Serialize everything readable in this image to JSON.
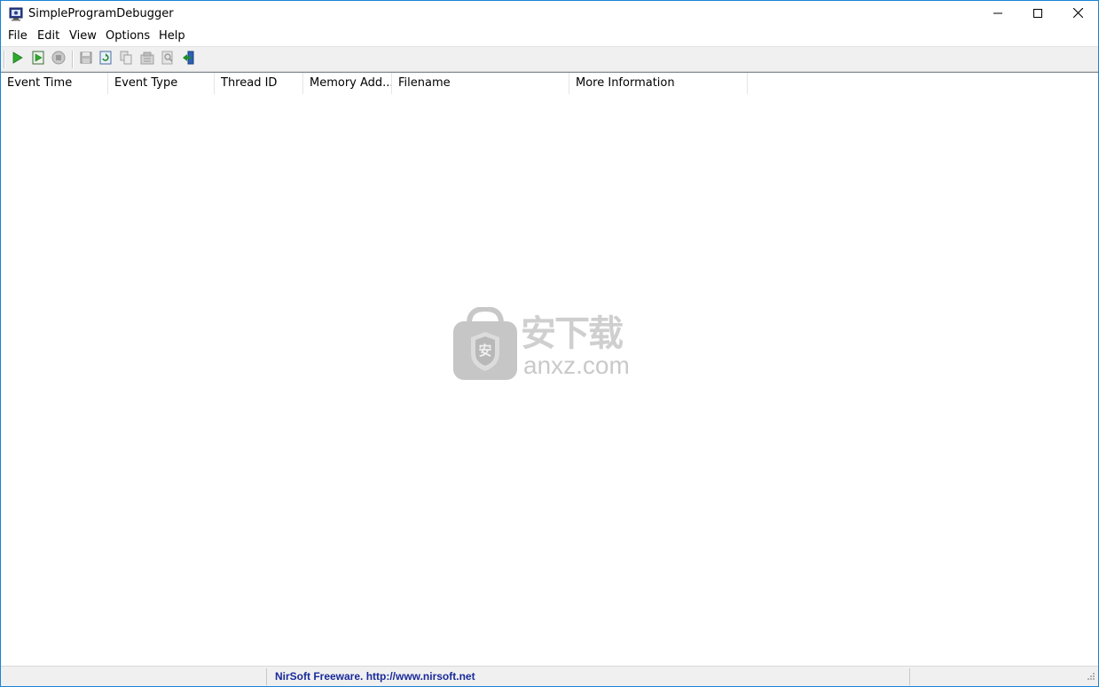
{
  "window": {
    "title": "SimpleProgramDebugger",
    "controls": {
      "minimize": "minimize-icon",
      "maximize": "maximize-icon",
      "close": "close-icon"
    }
  },
  "menu": [
    "File",
    "Edit",
    "View",
    "Options",
    "Help"
  ],
  "toolbar": {
    "buttons": [
      {
        "name": "start-debugging",
        "icon": "play-icon"
      },
      {
        "name": "start-debugging-options",
        "icon": "play-document-icon"
      },
      {
        "name": "stop-debugging",
        "icon": "stop-icon"
      },
      {
        "name": "save-selected-items",
        "icon": "save-icon"
      },
      {
        "name": "refresh",
        "icon": "refresh-icon"
      },
      {
        "name": "copy-selected-items",
        "icon": "copy-icon"
      },
      {
        "name": "properties",
        "icon": "properties-icon"
      },
      {
        "name": "find",
        "icon": "find-icon"
      },
      {
        "name": "exit",
        "icon": "exit-icon"
      }
    ]
  },
  "columns": [
    "Event Time",
    "Event Type",
    "Thread ID",
    "Memory Add...",
    "Filename",
    "More Information"
  ],
  "rows": [],
  "watermark": {
    "cn_text": "安下载",
    "domain_text": "anxz.com",
    "badge_glyph": "安"
  },
  "statusbar": {
    "text": "NirSoft Freeware.  http://www.nirsoft.net"
  },
  "colors": {
    "accent_border": "#1883d7",
    "status_link": "#1a2a9a",
    "toolbar_bg": "#f0f0f0",
    "play_green": "#2eaa2e"
  }
}
